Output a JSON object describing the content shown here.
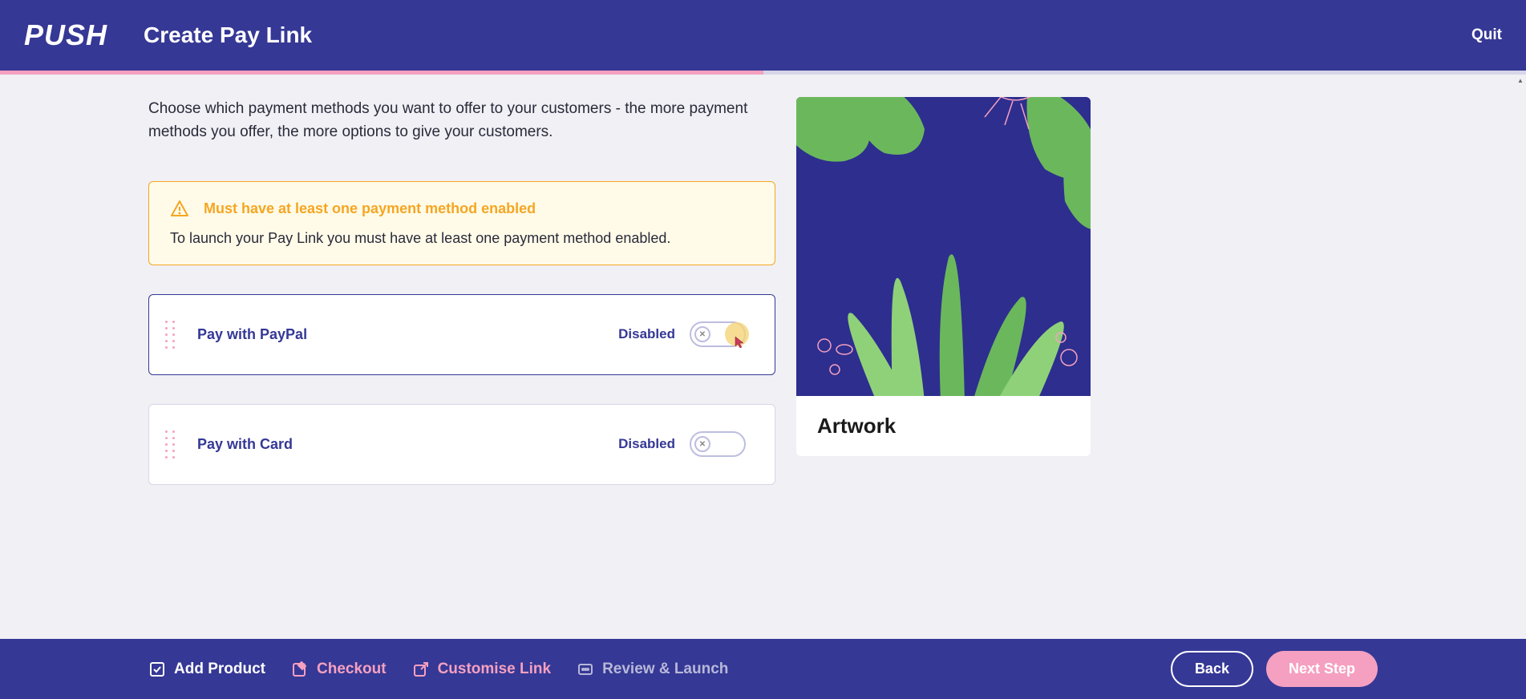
{
  "header": {
    "logo": "PUSH",
    "title": "Create Pay Link",
    "quit": "Quit"
  },
  "description": "Choose which payment methods you want to offer to your customers - the more payment methods you offer, the more options to give your customers.",
  "alert": {
    "title": "Must have at least one payment method enabled",
    "body": "To launch your Pay Link you must have at least one payment method enabled."
  },
  "methods": [
    {
      "name": "Pay with PayPal",
      "status": "Disabled",
      "active": true
    },
    {
      "name": "Pay with Card",
      "status": "Disabled",
      "active": false
    }
  ],
  "preview": {
    "title": "Artwork"
  },
  "footer": {
    "steps": [
      {
        "label": "Add Product",
        "style": "white",
        "icon": "check"
      },
      {
        "label": "Checkout",
        "style": "pink",
        "icon": "edit"
      },
      {
        "label": "Customise Link",
        "style": "pink",
        "icon": "external"
      },
      {
        "label": "Review & Launch",
        "style": "grey",
        "icon": "dots"
      }
    ],
    "back": "Back",
    "next": "Next Step"
  }
}
